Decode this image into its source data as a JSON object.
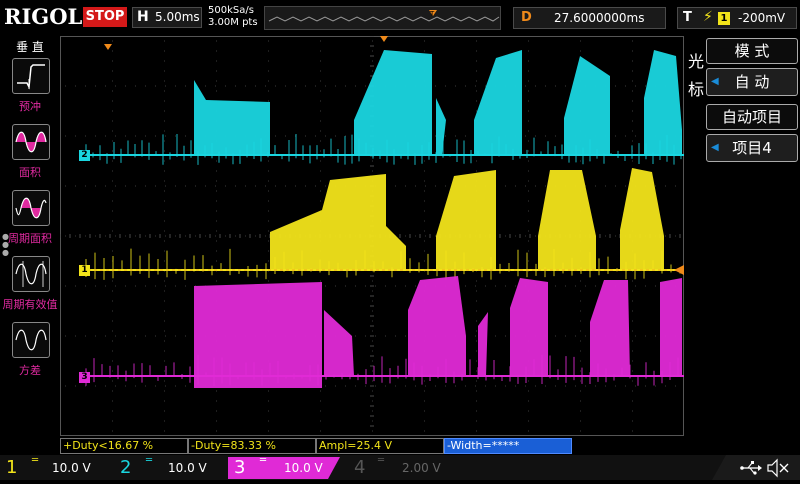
{
  "brand": "RIGOL",
  "run_state": "STOP",
  "horizontal": {
    "key": "H",
    "value": "5.00ms"
  },
  "sample_rate": {
    "rate": "500kSa/s",
    "points": "3.00M pts"
  },
  "delay": {
    "key": "D",
    "value": "27.6000000ms"
  },
  "trigger": {
    "key": "T",
    "source": "1",
    "level": "-200mV"
  },
  "left_menu": {
    "title": "垂 直",
    "items": [
      {
        "label": "预冲"
      },
      {
        "label": "面积"
      },
      {
        "label": "周期面积"
      },
      {
        "label": "周期有效值"
      },
      {
        "label": "方差"
      }
    ]
  },
  "right_menu": {
    "light_label": "光标",
    "mode_title": "模 式",
    "mode_value": "自 动",
    "auto_title": "自动项目",
    "auto_value": "项目4"
  },
  "channel_markers": {
    "ch1": "1",
    "ch2": "2",
    "ch3": "3"
  },
  "measurements": [
    {
      "text": "+Duty<16.67 %"
    },
    {
      "text": "-Duty=83.33 %"
    },
    {
      "text": "Ampl=25.4 V"
    },
    {
      "text": "-Width=*****"
    }
  ],
  "channels": [
    {
      "num": "1",
      "coupling": "═",
      "scale": "10.0 V",
      "color": "#f2e41a"
    },
    {
      "num": "2",
      "coupling": "═",
      "scale": "10.0 V",
      "color": "#1ad6e0"
    },
    {
      "num": "3",
      "coupling": "═",
      "scale": "10.0 V",
      "color": "#e02ad6"
    },
    {
      "num": "4",
      "coupling": "═",
      "scale": "2.00 V",
      "color": "#555555"
    }
  ],
  "colors": {
    "ch1": "#f2e41a",
    "ch2": "#1ad6e0",
    "ch3": "#e02ad6",
    "trigger": "#f08a1a",
    "stop": "#d41919"
  }
}
